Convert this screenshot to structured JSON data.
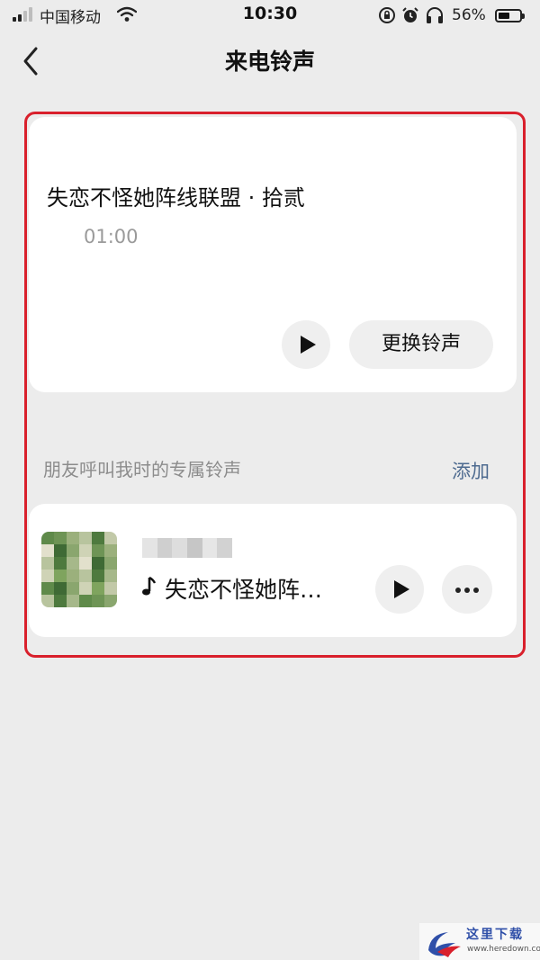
{
  "status_bar": {
    "carrier": "中国移动",
    "time": "10:30",
    "battery_percent": "56%",
    "battery_level": 0.56,
    "icons": [
      "signal-icon",
      "wifi-icon",
      "lock-rotation-icon",
      "alarm-icon",
      "headphones-icon",
      "battery-icon"
    ]
  },
  "nav": {
    "title": "来电铃声",
    "back_icon": "chevron-left-icon"
  },
  "current_ringtone": {
    "title": "失恋不怪她阵线联盟 · 拾贰",
    "duration": "01:00",
    "play_icon": "play-icon",
    "change_label": "更换铃声"
  },
  "friends_section": {
    "label": "朋友呼叫我时的专属铃声",
    "add_label": "添加",
    "items": [
      {
        "song": "失恋不怪她阵…",
        "note_icon": "music-note-icon",
        "play_icon": "play-icon",
        "more_icon": "more-icon"
      }
    ]
  },
  "watermark": {
    "text": "这里下载",
    "url": "www.heredown.com"
  },
  "colors": {
    "background": "#ececec",
    "card": "#ffffff",
    "highlight": "#d9202c",
    "link": "#4d6a8f",
    "muted_text": "#8c8c8c"
  }
}
